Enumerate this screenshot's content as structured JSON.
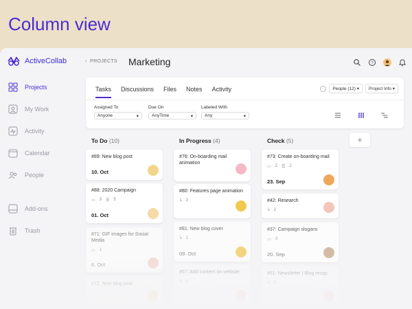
{
  "banner": {
    "title": "Column view"
  },
  "app": {
    "logo": "ActiveCollab",
    "sidebar": [
      {
        "label": "Projects",
        "icon": "grid-icon",
        "active": true
      },
      {
        "label": "My Work",
        "icon": "person-icon"
      },
      {
        "label": "Activity",
        "icon": "pulse-icon"
      },
      {
        "label": "Calendar",
        "icon": "calendar-icon"
      },
      {
        "label": "People",
        "icon": "people-icon"
      },
      {
        "label": "Add-ons",
        "icon": "addons-icon"
      },
      {
        "label": "Trash",
        "icon": "trash-icon"
      }
    ],
    "breadcrumb": "PROJECTS",
    "page_title": "Marketing",
    "header_icons": [
      "search-icon",
      "help-icon",
      "user-avatar",
      "bell-icon"
    ],
    "tabs": [
      "Tasks",
      "Discussions",
      "Files",
      "Notes",
      "Activity"
    ],
    "active_tab": "Tasks",
    "people_button": "People (12)",
    "project_info_button": "Project Info",
    "filters": [
      {
        "label": "Assigned To",
        "value": "Anyone"
      },
      {
        "label": "Due On",
        "value": "AnyTime"
      },
      {
        "label": "Labeled With",
        "value": "Any"
      }
    ],
    "view_icons": [
      "list-view-icon",
      "column-view-icon",
      "timeline-view-icon"
    ],
    "add_column": "+",
    "columns": [
      {
        "name": "To Do",
        "count": "(10)",
        "cards": [
          {
            "title": "#89: New blog post",
            "meta": [],
            "date": "10. Oct"
          },
          {
            "title": "#88: 2020 Campaign",
            "meta": [
              "3",
              "5"
            ],
            "date": "01. Oct"
          },
          {
            "title": "#71: GIF images for Social Media",
            "meta": [
              "1"
            ],
            "date": "6. Oct"
          },
          {
            "title": "#72: New blog post",
            "meta": [],
            "date": ""
          }
        ]
      },
      {
        "name": "In Progress",
        "count": "(4)",
        "cards": [
          {
            "title": "#76: On-boarding mail animation",
            "meta": [],
            "date": ""
          },
          {
            "title": "#80: Features page animation",
            "meta": [
              "2"
            ],
            "date": ""
          },
          {
            "title": "#81: New blog cover",
            "meta": [
              "1"
            ],
            "date": "09. Oct"
          },
          {
            "title": "#57: Add content on website",
            "meta": [
              "1"
            ],
            "date": ""
          }
        ]
      },
      {
        "name": "Check",
        "count": "(5)",
        "cards": [
          {
            "title": "#73: Create on-boarding mail",
            "meta": [
              "2",
              "2"
            ],
            "date": "23. Sep"
          },
          {
            "title": "#42: Research",
            "meta": [
              "2"
            ],
            "date": ""
          },
          {
            "title": "#37: Campaign slogans",
            "meta": [
              "3"
            ],
            "date": "20. Sep"
          },
          {
            "title": "#51: Newsletter | Blog recap",
            "meta": [
              "1"
            ],
            "date": ""
          }
        ]
      }
    ]
  }
}
